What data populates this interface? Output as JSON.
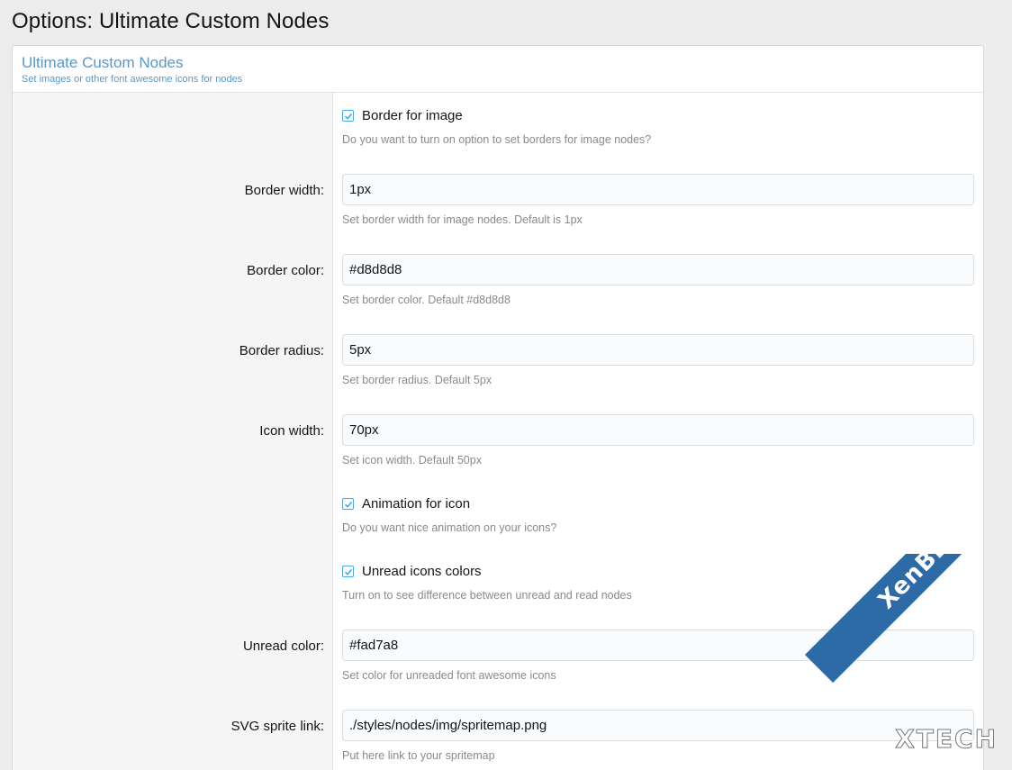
{
  "page": {
    "title": "Options: Ultimate Custom Nodes"
  },
  "block": {
    "title": "Ultimate Custom Nodes",
    "description": "Set images or other font awesome icons for nodes"
  },
  "options": {
    "border_for_image": {
      "label": "Border for image",
      "checked": true,
      "hint": "Do you want to turn on option to set borders for image nodes?"
    },
    "border_width": {
      "label": "Border width:",
      "value": "1px",
      "hint": "Set border width for image nodes. Default is 1px"
    },
    "border_color": {
      "label": "Border color:",
      "value": "#d8d8d8",
      "hint": "Set border color. Default #d8d8d8"
    },
    "border_radius": {
      "label": "Border radius:",
      "value": "5px",
      "hint": "Set border radius. Default 5px"
    },
    "icon_width": {
      "label": "Icon width:",
      "value": "70px",
      "hint": "Set icon width. Default 50px"
    },
    "animation_for_icon": {
      "label": "Animation for icon",
      "checked": true,
      "hint": "Do you want nice animation on your icons?"
    },
    "unread_icons_colors": {
      "label": "Unread icons colors",
      "checked": true,
      "hint": "Turn on to see difference between unread and read nodes"
    },
    "unread_color": {
      "label": "Unread color:",
      "value": "#fad7a8",
      "hint": "Set color for unreaded font awesome icons"
    },
    "svg_sprite_link": {
      "label": "SVG sprite link:",
      "value": "./styles/nodes/img/spritemap.png",
      "hint": "Put here link to your spritemap"
    }
  },
  "watermark": {
    "ribbon_text": "XenBD.Com",
    "corner_text": "XTECH"
  },
  "colors": {
    "accent": "#5c98c3",
    "checkbox_border": "#47a7eb",
    "ribbon": "#2d6aa8"
  }
}
